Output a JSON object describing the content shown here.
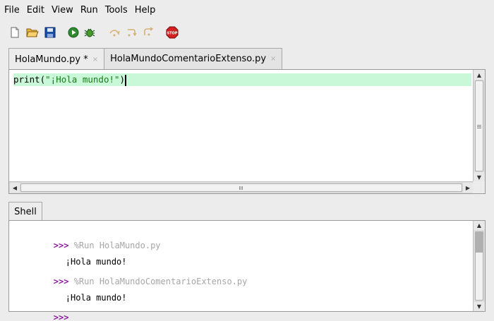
{
  "menu": {
    "items": [
      "File",
      "Edit",
      "View",
      "Run",
      "Tools",
      "Help"
    ]
  },
  "toolbar": {
    "icons": [
      "new-file-icon",
      "open-folder-icon",
      "save-icon",
      "run-icon",
      "debug-icon",
      "step-over-icon",
      "step-into-icon",
      "step-out-icon",
      "stop-icon"
    ],
    "stop_label": "STOP",
    "colors": {
      "run": "#2e8b2e",
      "stop": "#d42020",
      "save": "#1a4ea8"
    }
  },
  "editor": {
    "tabs": [
      {
        "label": "HolaMundo.py *",
        "close": "×"
      },
      {
        "label": "HolaMundoComentarioExtenso.py",
        "close": "×"
      }
    ],
    "code": {
      "fn": "print(",
      "str": "\"¡Hola mundo!\"",
      "close": ")"
    },
    "highlight_color": "#c8f8d8"
  },
  "shell": {
    "tab_label": "Shell",
    "lines": [
      {
        "prompt": ">>>",
        "cmd": " %Run HolaMundo.py"
      },
      {
        "out": "¡Hola mundo!"
      },
      {
        "prompt": ">>>",
        "cmd": " %Run HolaMundoComentarioExtenso.py"
      },
      {
        "out": "¡Hola mundo!"
      },
      {
        "prompt": ">>>",
        "cmd": ""
      }
    ],
    "colors": {
      "prompt": "#8a1a9a",
      "cmd": "#a6a6a6"
    }
  }
}
